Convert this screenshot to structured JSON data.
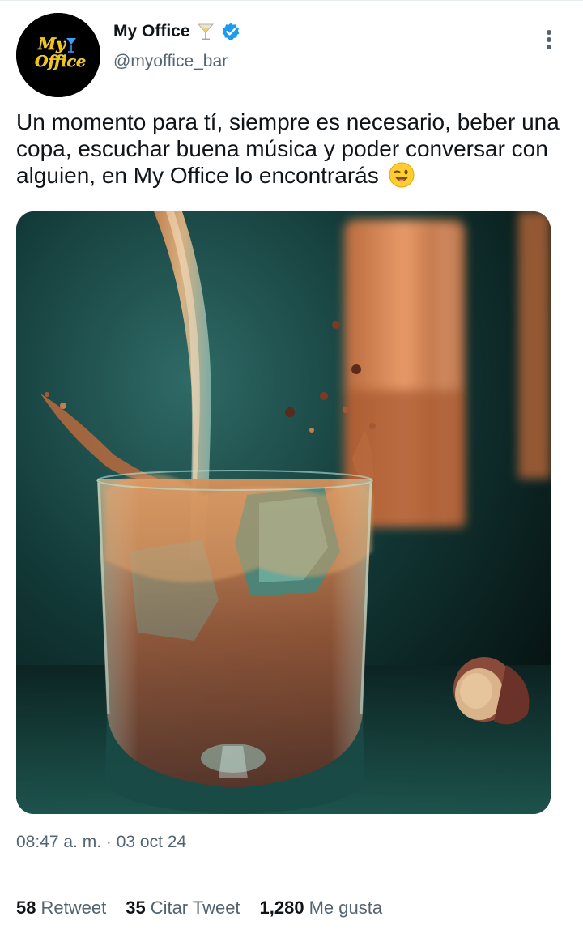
{
  "profile": {
    "name": "My Office",
    "handle": "@myoffice_bar",
    "avatar_text_top": "My",
    "avatar_text_bottom": "Office"
  },
  "tweet": {
    "text": "Un momento para tí, siempre es necesario, beber una copa, escuchar buena música y poder conversar con alguien, en My Office lo encontrarás",
    "emoji": "winking-face",
    "image_alt": "Whisky being poured into a glass with ice, bottle and cork in the background",
    "time": "08:47 a. m.",
    "date": "03 oct 24"
  },
  "stats": {
    "retweets": "58",
    "retweets_label": "Retweet",
    "quotes": "35",
    "quotes_label": "Citar Tweet",
    "likes": "1,280",
    "likes_label": "Me gusta"
  },
  "colors": {
    "verified": "#1d9bf0",
    "secondary_text": "#536471",
    "primary_text": "#0f1419",
    "logo_yellow": "#f5c400"
  },
  "icons": {
    "verified": "verified-badge-icon",
    "more": "more-vertical-icon",
    "cocktail": "cocktail-glass-icon"
  }
}
